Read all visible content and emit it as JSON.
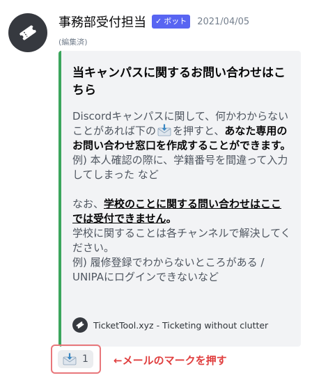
{
  "message": {
    "username": "事務部受付担当",
    "bot_tag": "ボット",
    "bot_tag_check": "✓",
    "timestamp": "2021/04/05",
    "edited": "(編集済)"
  },
  "embed": {
    "accent_color": "#3ba55c",
    "title": "当キャンパスに関するお問い合わせはこちら",
    "line1_a": "Discordキャンパスに関して、何かわからないことがあれば下の",
    "line1_b": "を押すと、",
    "line1_bold": "あなた専用のお問い合わせ窓口を作成することができます。",
    "line2": "例) 本人確認の際に、学籍番号を間違って入力してしまった など",
    "line3_a": "なお、",
    "line3_bold": "学校のことに関する問い合わせはここでは受付できません",
    "line3_end": "。",
    "line4": "学校に関することは各チャンネルで解決してください。",
    "line5": "例) 履修登録でわからないところがある / UNIPAにログインできないなど",
    "footer": "TicketTool.xyz - Ticketing without clutter"
  },
  "reaction": {
    "icon": "envelope-with-arrow-icon",
    "count": "1"
  },
  "annotation": "←メールのマークを押す",
  "colors": {
    "bot_tag": "#5865f2",
    "annotation": "#e03e3e",
    "highlight_frame": "#e8767a"
  }
}
